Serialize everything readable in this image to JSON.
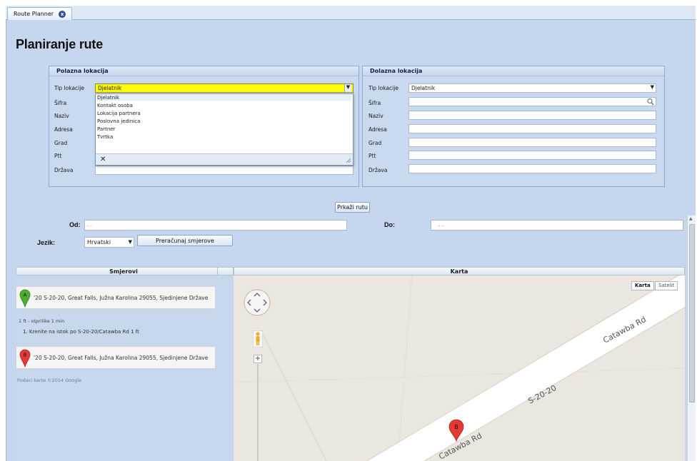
{
  "tab": {
    "label": "Route Planner"
  },
  "page_title": "Planiranje rute",
  "start": {
    "legend": "Polazna lokacija",
    "labels": [
      "Tip lokacije",
      "Šifra",
      "Naziv",
      "Adresa",
      "Grad",
      "Ptt",
      "Država"
    ],
    "tip_value": "Djelatnik",
    "dropdown_options": [
      "Djelatnik",
      "Kontakt osoba",
      "Lokacija partnera",
      "Poslovna jedinica",
      "Partner",
      "Tvrtka"
    ]
  },
  "end": {
    "legend": "Dolazna lokacija",
    "labels": [
      "Tip lokacije",
      "Šifra",
      "Naziv",
      "Adresa",
      "Grad",
      "Ptt",
      "Država"
    ],
    "tip_value": "Djelatnik"
  },
  "show_route_button": "Prkaži rutu",
  "od_label": "Od:",
  "od_value": ". .",
  "do_label": "Do:",
  "do_value": ". .",
  "jezik_label": "Jezik:",
  "jezik_value": "Hrvatski",
  "recalc_button": "Preračunaj smjerove",
  "directions": {
    "header": "Smjerovi",
    "marker_a": "A",
    "marker_b": "B",
    "address_a": "'20 S-20-20, Great Falls, Južna Karolina 29055, Sjedinjene Države",
    "summary": "1 ft - otprilike 1 min",
    "step": "1.  Krenite na istok po S-20-20/Catawba Rd  1 ft",
    "address_b": "'20 S-20-20, Great Falls, Južna Karolina 29055, Sjedinjene Države",
    "copyright": "Podaci karte ©2014 Google"
  },
  "map": {
    "header": "Karta",
    "type_map": "Karta",
    "type_satellite": "Satelit",
    "road_catawba_top": "Catawba Rd",
    "road_s2020": "S-20-20",
    "road_catawba_bottom": "Catawba Rd",
    "marker_b": "B",
    "zoom_in": "+"
  },
  "colors": {
    "panel_bg": "#c5d6ee",
    "selected_field": "#ffff00",
    "marker_a": "#4caf2e",
    "marker_b": "#e53935"
  }
}
